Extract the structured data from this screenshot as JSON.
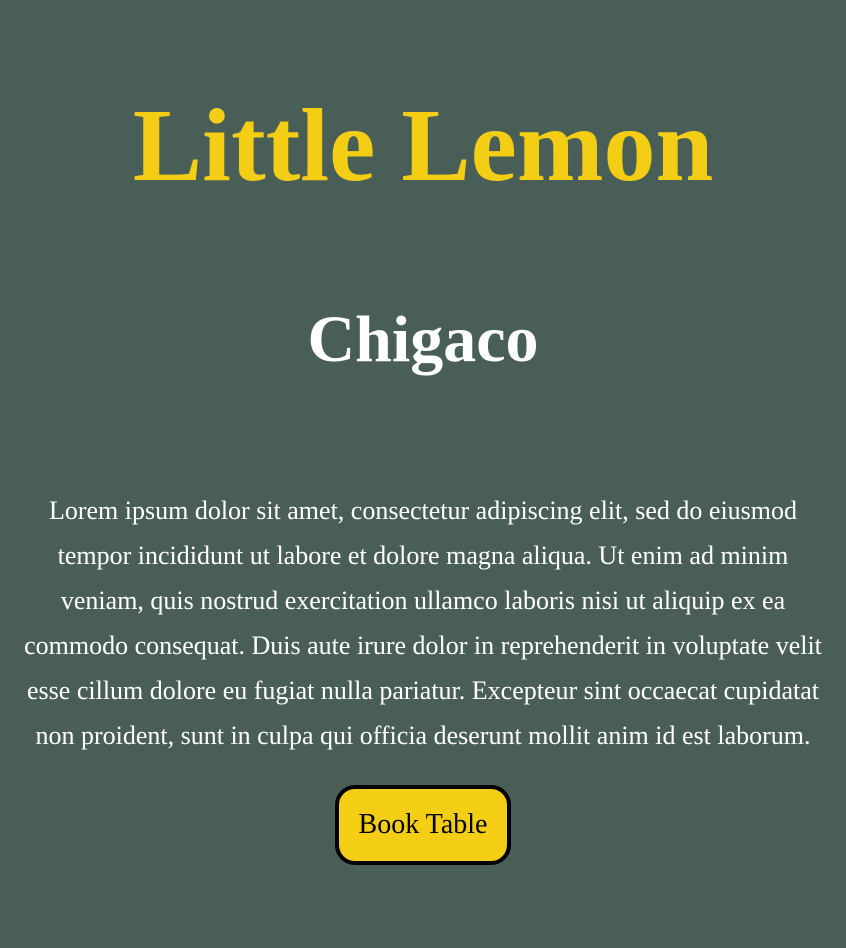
{
  "colors": {
    "background": "#495e57",
    "accent": "#f4ce14",
    "text": "#ffffff"
  },
  "title": "Little Lemon",
  "subtitle": "Chigaco",
  "description": "Lorem ipsum dolor sit amet, consectetur adipiscing elit, sed do eiusmod tempor incididunt ut labore et dolore magna aliqua. Ut enim ad minim veniam, quis nostrud exercitation ullamco laboris nisi ut aliquip ex ea commodo consequat. Duis aute irure dolor in reprehenderit in voluptate velit esse cillum dolore eu fugiat nulla pariatur. Excepteur sint occaecat cupidatat non proident, sunt in culpa qui officia deserunt mollit anim id est laborum.",
  "book_button": "Book Table"
}
